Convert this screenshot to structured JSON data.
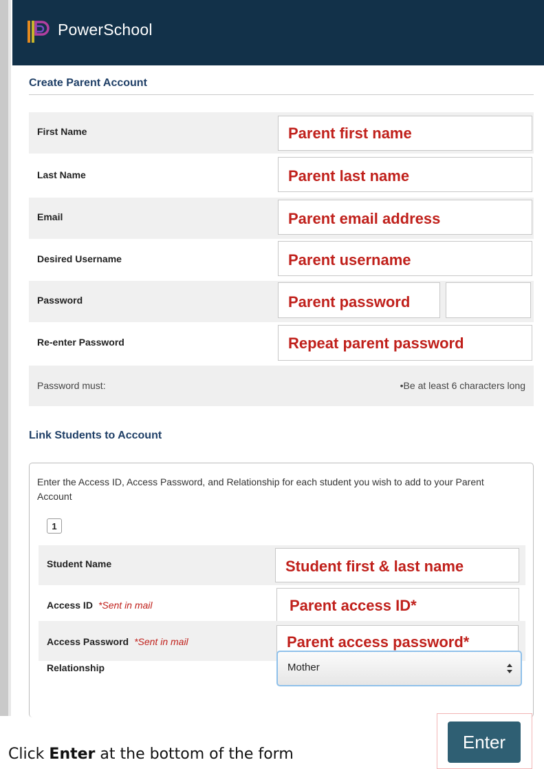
{
  "header": {
    "brand": "PowerSchool"
  },
  "account": {
    "title": "Create Parent Account",
    "fields": [
      {
        "label": "First Name",
        "value": "Parent first name"
      },
      {
        "label": "Last Name",
        "value": "Parent last name"
      },
      {
        "label": "Email",
        "value": "Parent email address"
      },
      {
        "label": "Desired Username",
        "value": "Parent username"
      },
      {
        "label": "Password",
        "value": "Parent password"
      },
      {
        "label": "Re-enter Password",
        "value": "Repeat parent password"
      }
    ],
    "password_rule_label": "Password must:",
    "password_rule": "•Be at least 6 characters long"
  },
  "students": {
    "title": "Link Students to Account",
    "instructions": "Enter the Access ID, Access Password, and Relationship for each student you wish to add to your Parent Account",
    "tab_number": "1",
    "student_name_label": "Student Name",
    "student_name_value": "Student first & last name",
    "access_id_label": "Access ID",
    "access_id_note": "*Sent in mail",
    "access_id_value": "Parent access ID*",
    "access_password_label": "Access Password",
    "access_password_note": "*Sent in mail",
    "access_password_value": "Parent access password*",
    "relationship_label": "Relationship",
    "relationship_value": "Mother"
  },
  "actions": {
    "enter": "Enter"
  },
  "caption": {
    "prefix": "Click ",
    "bold": "Enter",
    "suffix": " at the bottom of the form"
  },
  "colors": {
    "header": "#123149",
    "annotation_red": "#c0201b",
    "section_title": "#1e3e66",
    "enter_button": "#2f5f73"
  }
}
